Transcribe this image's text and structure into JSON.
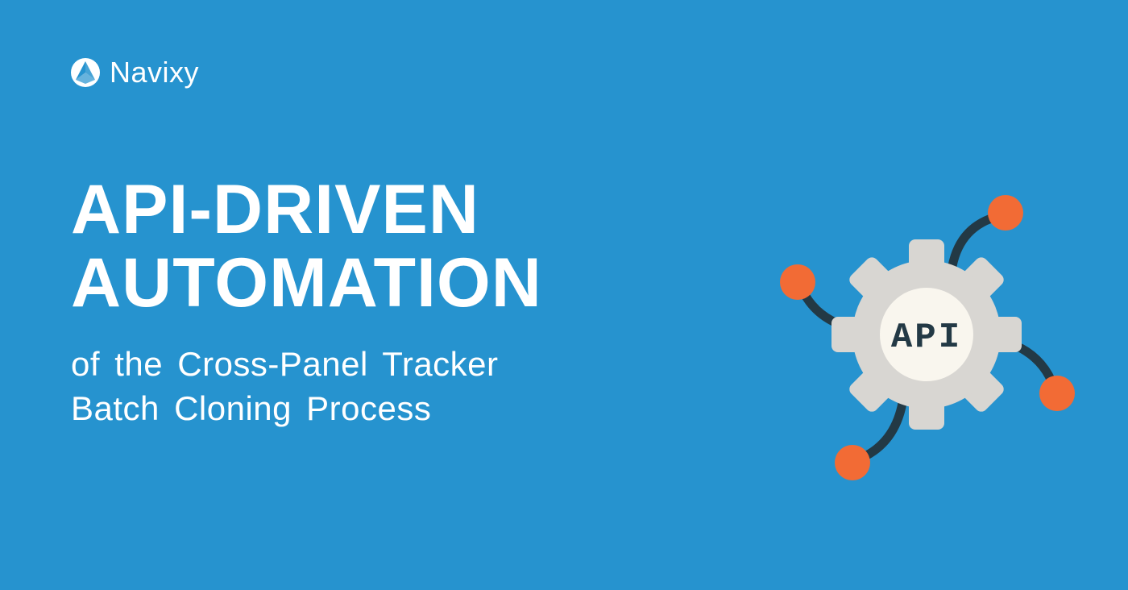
{
  "brand": {
    "name": "Navixy"
  },
  "headline": {
    "line1": "API-DRIVEN",
    "line2": "AUTOMATION"
  },
  "subline": {
    "line1": "of the Cross-Panel Tracker",
    "line2": "Batch Cloning Process"
  },
  "gear_label": "API",
  "colors": {
    "background": "#2693cf",
    "accent_orange": "#f26b35",
    "gear_fill": "#d8d6d2",
    "gear_center": "#f9f6ee",
    "connector": "#233945",
    "text": "#ffffff"
  }
}
